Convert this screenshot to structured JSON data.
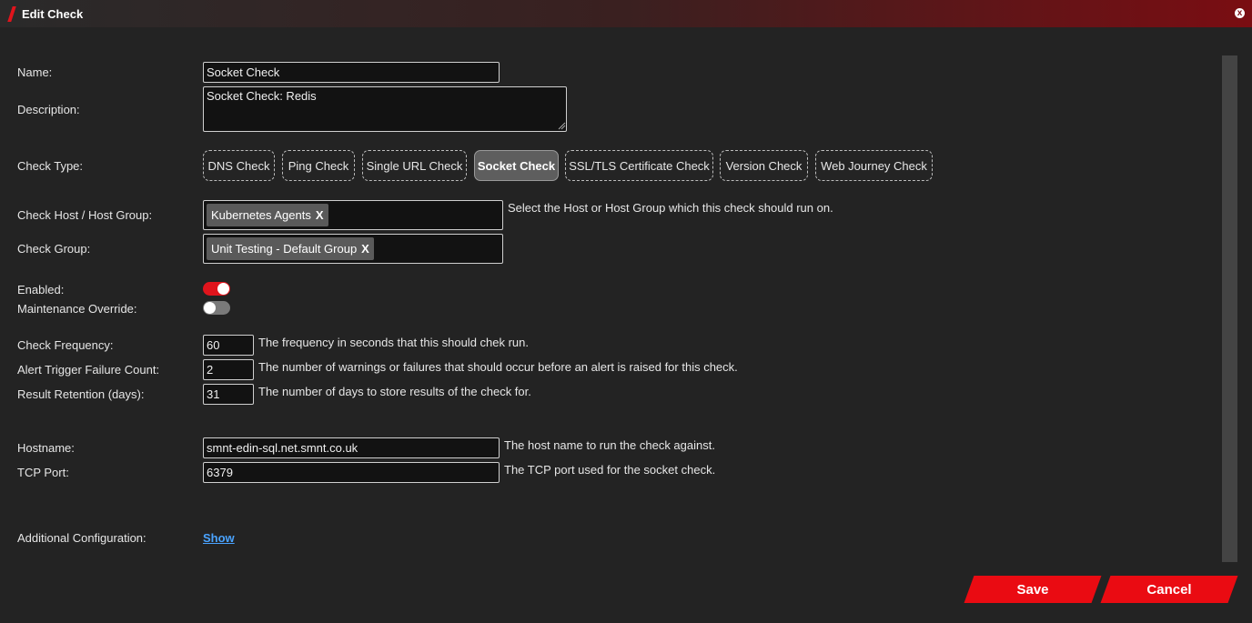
{
  "window": {
    "title": "Edit Check",
    "close_label": "x"
  },
  "form": {
    "name": {
      "label": "Name:",
      "value": "Socket Check"
    },
    "description": {
      "label": "Description:",
      "value": "Socket Check: Redis"
    },
    "check_type": {
      "label": "Check Type:",
      "options": [
        "DNS Check",
        "Ping Check",
        "Single URL Check",
        "Socket Check",
        "SSL/TLS Certificate Check",
        "Version Check",
        "Web Journey Check"
      ],
      "selected": "Socket Check"
    },
    "host_group": {
      "label": "Check Host / Host Group:",
      "tag": "Kubernetes Agents",
      "help": "Select the Host or Host Group which this check should run on."
    },
    "check_group": {
      "label": "Check Group:",
      "tag": "Unit Testing - Default Group"
    },
    "enabled": {
      "label": "Enabled:",
      "on": true
    },
    "maintenance": {
      "label": "Maintenance Override:",
      "on": false
    },
    "frequency": {
      "label": "Check Frequency:",
      "value": "60",
      "help": "The frequency in seconds that this should chek run."
    },
    "failure_count": {
      "label": "Alert Trigger Failure Count:",
      "value": "2",
      "help": "The number of warnings or failures that should occur before an alert is raised for this check."
    },
    "retention": {
      "label": "Result Retention (days):",
      "value": "31",
      "help": "The number of days to store results of the check for."
    },
    "hostname": {
      "label": "Hostname:",
      "value": "smnt-edin-sql.net.smnt.co.uk",
      "help": "The host name to run the check against."
    },
    "tcp_port": {
      "label": "TCP Port:",
      "value": "6379",
      "help": "The TCP port used for the socket check."
    },
    "additional": {
      "label": "Additional Configuration:",
      "link": "Show"
    }
  },
  "tag_remove": "X",
  "actions": {
    "save": "Save",
    "cancel": "Cancel"
  },
  "colors": {
    "accent": "#ea0b12",
    "background": "#232323",
    "link": "#4aa3ff"
  }
}
